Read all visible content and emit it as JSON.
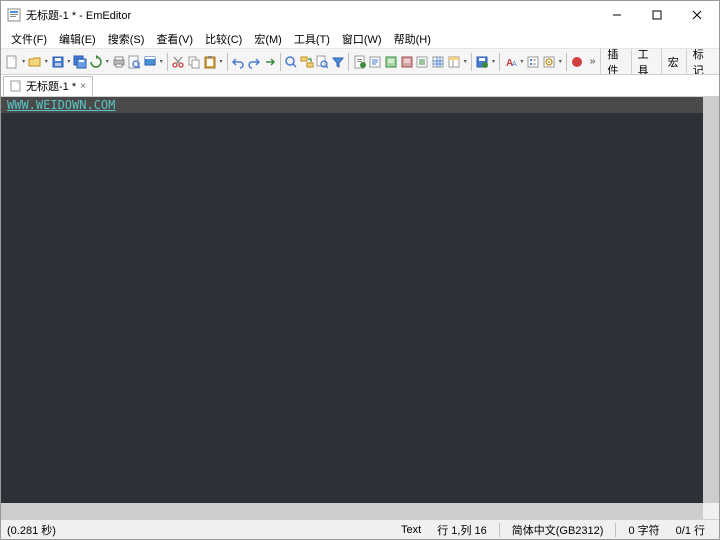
{
  "window": {
    "title": "无标题-1 * - EmEditor"
  },
  "menu": {
    "items": [
      "文件(F)",
      "编辑(E)",
      "搜索(S)",
      "查看(V)",
      "比较(C)",
      "宏(M)",
      "工具(T)",
      "窗口(W)",
      "帮助(H)"
    ]
  },
  "toolbar_tabs": [
    "插件",
    "工具",
    "宏",
    "标记"
  ],
  "doc_tab": {
    "label": "无标题-1 *",
    "close": "×"
  },
  "editor": {
    "line1": "WWW.WEIDOWN.COM"
  },
  "status": {
    "time": "(0.281 秒)",
    "mode": "Text",
    "pos": "行 1,列 16",
    "encoding": "简体中文(GB2312)",
    "chars": "0 字符",
    "lines": "0/1 行"
  }
}
